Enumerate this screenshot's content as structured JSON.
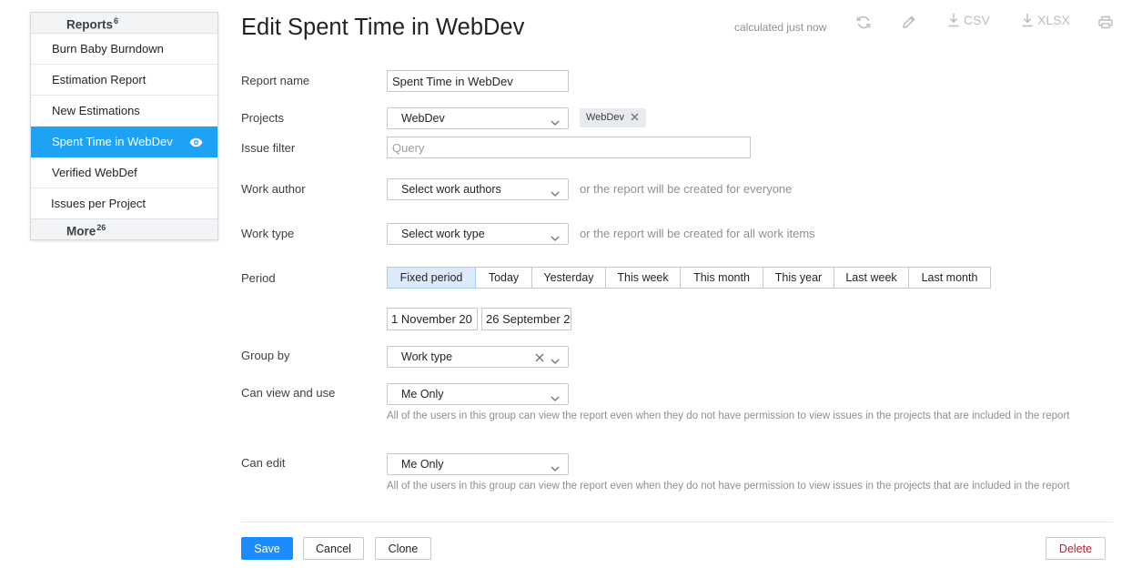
{
  "sidebar": {
    "header": {
      "label": "Reports",
      "count": "6"
    },
    "items": [
      {
        "label": "Burn Baby Burndown",
        "active": false
      },
      {
        "label": "Estimation Report",
        "active": false
      },
      {
        "label": "New Estimations",
        "active": false
      },
      {
        "label": "Spent Time in WebDev",
        "active": true
      },
      {
        "label": "Verified WebDef",
        "active": false
      },
      {
        "label": "Issues per Project",
        "active": false
      }
    ],
    "footer": {
      "label": "More",
      "count": "26"
    }
  },
  "header": {
    "title": "Edit Spent Time in WebDev",
    "calculated": "calculated just now",
    "csv_label": "CSV",
    "xlsx_label": "XLSX"
  },
  "form": {
    "report_name": {
      "label": "Report name",
      "value": "Spent Time in WebDev"
    },
    "projects": {
      "label": "Projects",
      "value": "WebDev",
      "tag": "WebDev"
    },
    "issue_filter": {
      "label": "Issue filter",
      "placeholder": "Query"
    },
    "work_author": {
      "label": "Work author",
      "value": "Select work authors",
      "hint": "or the report will be created for everyone"
    },
    "work_type": {
      "label": "Work type",
      "value": "Select work type",
      "hint": "or the report will be created for all work items"
    },
    "period": {
      "label": "Period",
      "options": [
        "Fixed period",
        "Today",
        "Yesterday",
        "This week",
        "This month",
        "This year",
        "Last week",
        "Last month"
      ],
      "selected": "Fixed period",
      "from": "1 November 20",
      "to": "26 September 2"
    },
    "group_by": {
      "label": "Group by",
      "value": "Work type"
    },
    "can_view": {
      "label": "Can view and use",
      "value": "Me Only",
      "note": "All of the users in this group can view the report even when they do not have permission to view issues in the projects that are included in the report"
    },
    "can_edit": {
      "label": "Can edit",
      "value": "Me Only",
      "note": "All of the users in this group can view the report even when they do not have permission to view issues in the projects that are included in the report"
    }
  },
  "actions": {
    "save": "Save",
    "cancel": "Cancel",
    "clone": "Clone",
    "delete": "Delete"
  },
  "colors": {
    "accent": "#1ea2f4",
    "primary_button": "#1a8cff",
    "danger_text": "#b1273a",
    "selected_segment": "#dcebfb"
  }
}
